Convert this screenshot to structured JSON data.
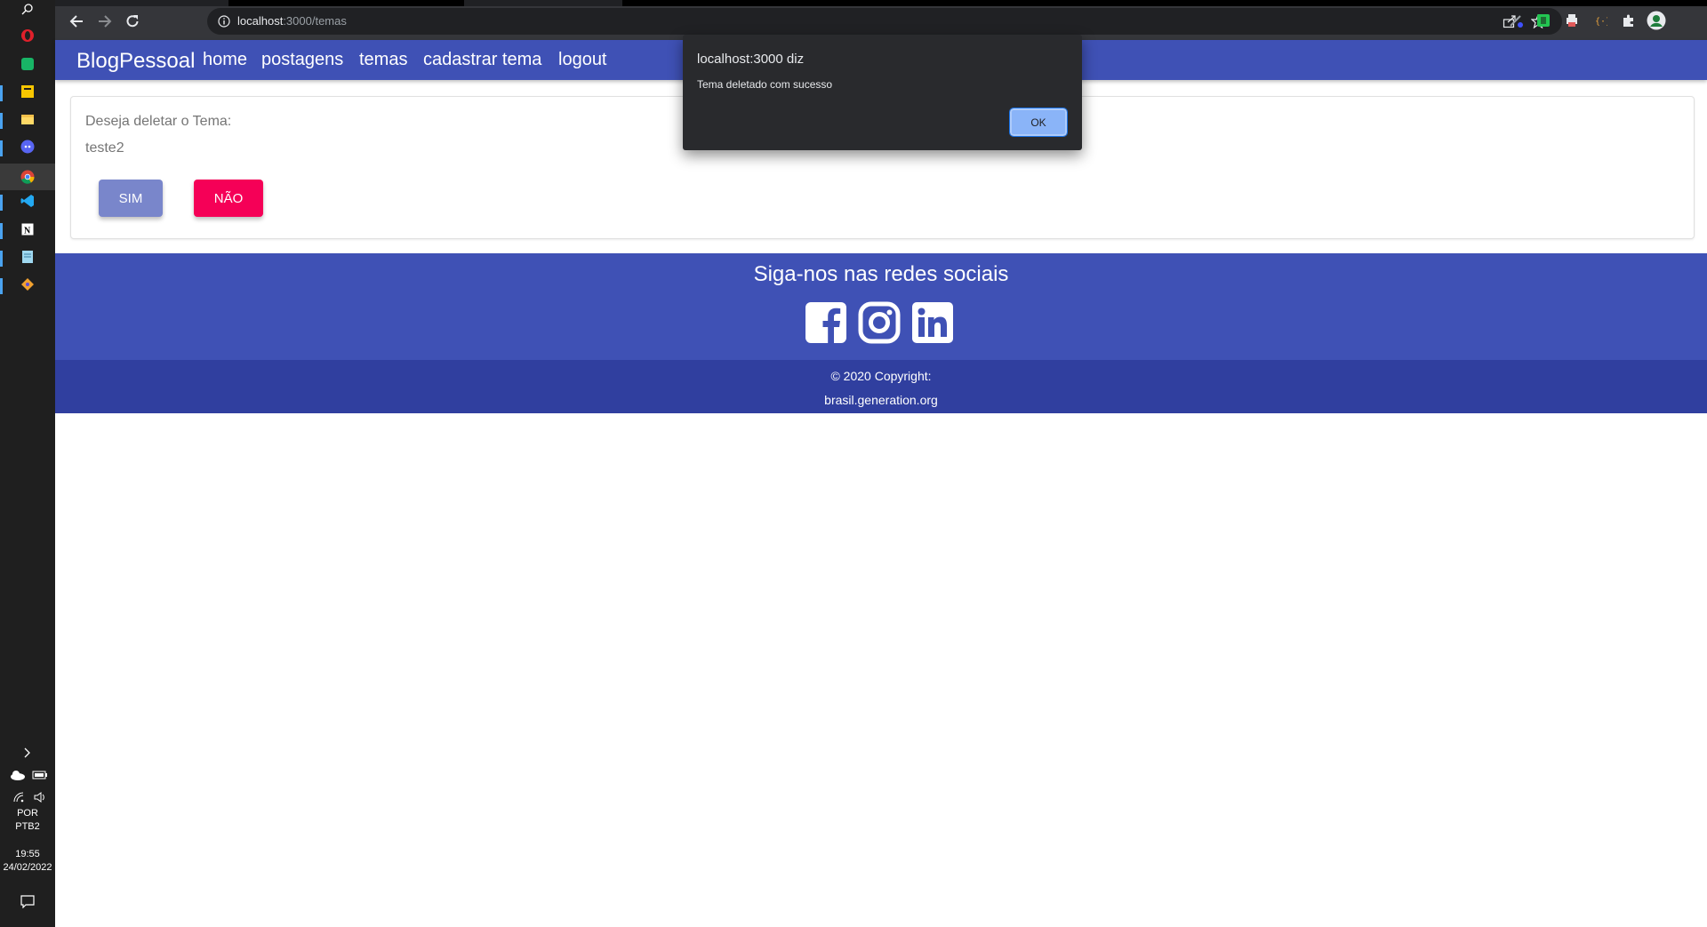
{
  "browser": {
    "url_host": "localhost",
    "url_path": ":3000/temas"
  },
  "taskbar": {
    "lang_1": "POR",
    "lang_2": "PTB2",
    "time": "19:55",
    "date": "24/02/2022"
  },
  "navbar": {
    "brand": "BlogPessoal",
    "links": [
      "home",
      "postagens",
      "temas",
      "cadastrar tema",
      "logout"
    ]
  },
  "delete_card": {
    "question": "Deseja deletar o Tema:",
    "theme_name": "teste2",
    "yes_label": "SIM",
    "no_label": "NÃO"
  },
  "footer": {
    "title": "Siga-nos nas redes sociais",
    "copyright": "© 2020 Copyright:",
    "site": "brasil.generation.org"
  },
  "alert": {
    "title": "localhost:3000 diz",
    "message": "Tema deletado com sucesso",
    "ok_label": "OK"
  },
  "colors": {
    "primary": "#3f51b5",
    "primary_dark": "#303f9f",
    "secondary": "#f50057",
    "sim_button": "#7986cb"
  }
}
